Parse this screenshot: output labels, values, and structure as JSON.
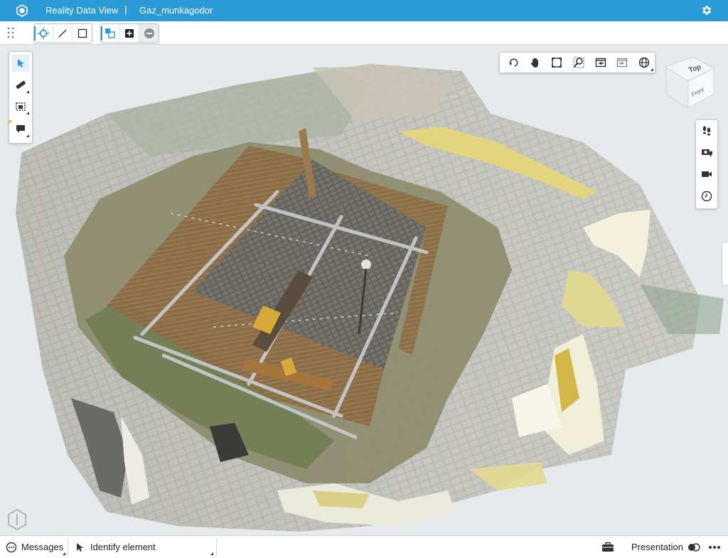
{
  "titlebar": {
    "app_name": "Reality Data View",
    "separator": "|",
    "document_name": "Gaz_munkagodor",
    "bg_color": "#2a9bd6"
  },
  "toolbar": {
    "groups": [
      [
        "select-point-icon",
        "line-icon",
        "rectangle-icon"
      ],
      [
        "fence-select-icon",
        "add-icon",
        "remove-icon"
      ]
    ]
  },
  "left_tools": [
    "pointer-icon",
    "measure-icon",
    "clip-volume-icon",
    "annotation-icon"
  ],
  "view_tools": [
    "rotate-icon",
    "pan-icon",
    "fit-view-icon",
    "zoom-window-icon",
    "previous-view-icon",
    "next-view-icon",
    "geo-location-icon"
  ],
  "navigation_cube": {
    "top_label": "Top",
    "front_label": "Front"
  },
  "right_tools": [
    "walk-icon",
    "camera-location-icon",
    "video-camera-icon",
    "clock-icon"
  ],
  "statusbar": {
    "messages_label": "Messages",
    "identify_label": "Identify element",
    "presentation_label": "Presentation"
  }
}
